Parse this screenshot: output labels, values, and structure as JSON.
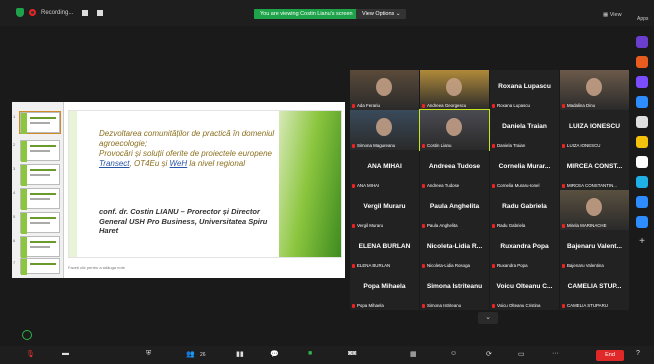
{
  "topbar": {
    "recording_label": "Recording...",
    "banner": "You are viewing Costin Lianu's screen",
    "view_options": "View Options",
    "view_label": "View",
    "apps_label": "Apps"
  },
  "slide": {
    "title_line1": "Dezvoltarea comunităților de practică în domeniul agroecologie;",
    "title_line2_pre": "Provocări și soluții oferite de proiectele europene ",
    "title_link1": "Transect",
    "title_mid": ", OT4Eu și ",
    "title_link2": "WeH",
    "title_end": " la nivel regional",
    "author": "conf. dr. Costin LIANU – Prorector și Director General USH Pro Business, Universitatea Spiru Haret",
    "notes_placeholder": "Faceți clic pentru a adăuga note",
    "thumb_numbers": [
      "1",
      "2",
      "3",
      "4",
      "5",
      "6",
      "7"
    ]
  },
  "participants": [
    {
      "name": "",
      "label": "Ada Ferariu",
      "video": true
    },
    {
      "name": "",
      "label": "Andreea Georgescu",
      "video": true
    },
    {
      "name": "Roxana Lupascu",
      "label": "Roxana Lupascu",
      "video": false
    },
    {
      "name": "",
      "label": "Madalina Dinu",
      "video": true
    },
    {
      "name": "",
      "label": "Simona Magureanu",
      "video": true
    },
    {
      "name": "",
      "label": "Costin Lianu",
      "video": true
    },
    {
      "name": "Daniela Traian",
      "label": "Daniela Traian",
      "video": false
    },
    {
      "name": "LUIZA IONESCU",
      "label": "LUIZA IONESCU",
      "video": false
    },
    {
      "name": "ANA MIHAI",
      "label": "ANA MIHAI",
      "video": false
    },
    {
      "name": "Andreea Tudose",
      "label": "Andreea Tudose",
      "video": false
    },
    {
      "name": "Cornelia Murar...",
      "label": "Cornelia Muraru-Ionel",
      "video": false
    },
    {
      "name": "MIRCEA CONST...",
      "label": "MIRCEA CONSTANTIN...",
      "video": false
    },
    {
      "name": "Vergil Muraru",
      "label": "Vergil Muraru",
      "video": false
    },
    {
      "name": "Paula Anghelita",
      "label": "Paula Anghelita",
      "video": false
    },
    {
      "name": "Radu Gabriela",
      "label": "Radu Gabriela",
      "video": false
    },
    {
      "name": "",
      "label": "Mirela MARINACHE",
      "video": true
    },
    {
      "name": "ELENA BURLAN",
      "label": "ELENA BURLAN",
      "video": false
    },
    {
      "name": "Nicoleta-Lidia R...",
      "label": "Nicoleta-Lidia Rosoga",
      "video": false
    },
    {
      "name": "Ruxandra Popa",
      "label": "Ruxandra Popa",
      "video": false
    },
    {
      "name": "Bajenaru Valent...",
      "label": "Bajenaru Valentina",
      "video": false
    },
    {
      "name": "Popa Mihaela",
      "label": "Popa Mihaela",
      "video": false
    },
    {
      "name": "Simona Istriteanu",
      "label": "Simona Istriteanu",
      "video": false
    },
    {
      "name": "Voicu Olteanu C...",
      "label": "Voicu Olteanu Cristina",
      "video": false
    },
    {
      "name": "CAMELIA STUP...",
      "label": "CAMELIA STUPARU",
      "video": false
    }
  ],
  "bottombar": {
    "participants_count": "26",
    "end_label": "End"
  },
  "colors": {
    "banner_green": "#1fa34a",
    "end_red": "#e02828",
    "active_speaker": "#c8e51a"
  }
}
